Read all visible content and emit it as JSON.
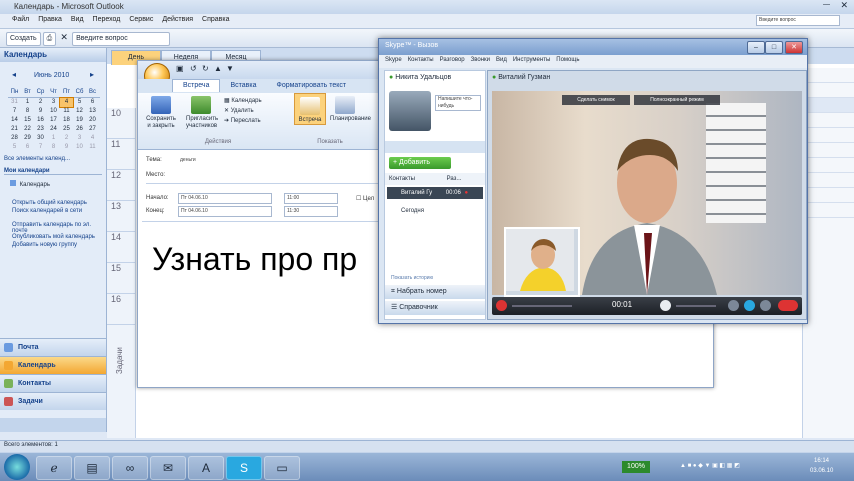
{
  "outlook": {
    "title": "Календарь - Microsoft Outlook",
    "menu": [
      "Файл",
      "Правка",
      "Вид",
      "Переход",
      "Сервис",
      "Действия",
      "Справка"
    ],
    "toolbar": {
      "create_label": "Создать",
      "search_placeholder": "Введите вопрос"
    },
    "help_box": "Введите вопрос"
  },
  "nav": {
    "header": "Календарь",
    "month_label": "Июнь 2010",
    "weekdays": [
      "Пн",
      "Вт",
      "Ср",
      "Чт",
      "Пт",
      "Сб",
      "Вс"
    ],
    "weeks": [
      [
        "31",
        "1",
        "2",
        "3",
        "4",
        "5",
        "6"
      ],
      [
        "7",
        "8",
        "9",
        "10",
        "11",
        "12",
        "13"
      ],
      [
        "14",
        "15",
        "16",
        "17",
        "18",
        "19",
        "20"
      ],
      [
        "21",
        "22",
        "23",
        "24",
        "25",
        "26",
        "27"
      ],
      [
        "28",
        "29",
        "30",
        "1",
        "2",
        "3",
        "4"
      ],
      [
        "5",
        "6",
        "7",
        "8",
        "9",
        "10",
        "11"
      ]
    ],
    "all_calendars": "Все элементы календ...",
    "my_calendars": "Мои календари",
    "calendar_item": "Календарь",
    "links": [
      "Открыть общий календарь",
      "Поиск календарей в сети",
      "Отправить календарь по эл. почте",
      "Опубликовать мой календарь",
      "Добавить новую группу"
    ],
    "sections": [
      "Почта",
      "Календарь",
      "Контакты",
      "Задачи"
    ]
  },
  "calendar": {
    "tabs": [
      "День",
      "Неделя",
      "Месяц"
    ],
    "hours": [
      "10",
      "11",
      "12",
      "13",
      "14",
      "15",
      "16"
    ],
    "tasks_label": "Задачи"
  },
  "meeting": {
    "ribbon_tabs": [
      "Встреча",
      "Вставка",
      "Форматировать текст"
    ],
    "actions": {
      "save_close": "Сохранить и закрыть",
      "invite": "Пригласить участников",
      "calendar": "Календарь",
      "delete": "Удалить",
      "forward": "Переслать"
    },
    "show": {
      "appointment": "Встреча",
      "scheduling": "Планирование"
    },
    "groups": {
      "actions": "Действия",
      "show": "Показать"
    },
    "subject_label": "Тема:",
    "subject_value": "деньги",
    "location_label": "Место:",
    "start_label": "Начало:",
    "start_date": "Пт 04.06.10",
    "start_time": "11:00",
    "end_label": "Конец:",
    "end_date": "Пт 04.06.10",
    "end_time": "11:30",
    "allday_label": "Цел",
    "body_text": "Узнать про пр"
  },
  "skype": {
    "title": "Skype™ - Вызов",
    "menu": [
      "Skype",
      "Контакты",
      "Разговор",
      "Звонки",
      "Вид",
      "Инструменты",
      "Помощь"
    ],
    "user_name": "Никита Удальцов",
    "contact_name": "Виталий Гузман",
    "add_contact": "Добавить контакты",
    "mood_prompt": "Напишите что-нибудь",
    "add_button": "Добавить",
    "contacts_tab": "Контакты",
    "recent_tab": "Раз...",
    "call_item_name": "Виталий Гу",
    "call_item_time": "00:06",
    "today_label": "Сегодня",
    "history_link": "Показать историю",
    "dial_button": "Набрать номер",
    "directory_button": "Справочник",
    "snapshot_btn": "Сделать снимок",
    "fullscreen_btn": "Полноэкранный режим",
    "call_timer": "00:01"
  },
  "status_bar": "Всего элементов: 1",
  "taskbar": {
    "battery": "100%",
    "time": "16:14",
    "date": "03.06.10"
  }
}
